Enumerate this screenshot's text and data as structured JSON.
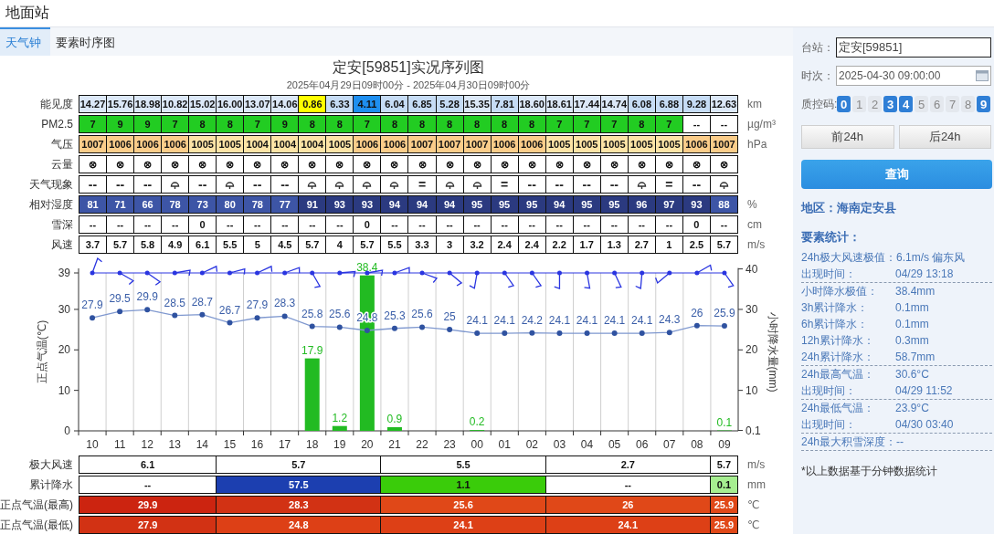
{
  "title_bar": {
    "title": "地面站"
  },
  "tabs": [
    {
      "label": "天气钟",
      "selected": true
    },
    {
      "label": "要素时序图",
      "selected": false
    }
  ],
  "chart_header": {
    "title": "定安[59851]实况序列图",
    "subtitle": "2025年04月29日09时00分 - 2025年04月30日09时00分"
  },
  "top_table": {
    "rows": [
      {
        "label": "能见度",
        "unit": "km",
        "cells": [
          {
            "text": "14.27",
            "color": "#dce8f8"
          },
          {
            "text": "15.76",
            "color": "#dce8f8"
          },
          {
            "text": "18.98",
            "color": "#dce8f8"
          },
          {
            "text": "10.82",
            "color": "#dce8f8"
          },
          {
            "text": "15.02",
            "color": "#dce8f8"
          },
          {
            "text": "16.00",
            "color": "#dce8f8"
          },
          {
            "text": "13.07",
            "color": "#dce8f8"
          },
          {
            "text": "14.06",
            "color": "#dce8f8"
          },
          {
            "text": "0.86",
            "color": "#ffff00"
          },
          {
            "text": "6.33",
            "color": "#c6dcf5"
          },
          {
            "text": "4.11",
            "color": "#1e8ff0"
          },
          {
            "text": "6.04",
            "color": "#c6dcf5"
          },
          {
            "text": "6.85",
            "color": "#c6dcf5"
          },
          {
            "text": "5.28",
            "color": "#c6dcf5"
          },
          {
            "text": "15.35",
            "color": "#dce8f8"
          },
          {
            "text": "7.81",
            "color": "#c6dcf5"
          },
          {
            "text": "18.60",
            "color": "#dce8f8"
          },
          {
            "text": "18.61",
            "color": "#dce8f8"
          },
          {
            "text": "17.44",
            "color": "#dce8f8"
          },
          {
            "text": "14.74",
            "color": "#dce8f8"
          },
          {
            "text": "6.08",
            "color": "#c6dcf5"
          },
          {
            "text": "6.88",
            "color": "#c6dcf5"
          },
          {
            "text": "9.28",
            "color": "#c6dcf5"
          },
          {
            "text": "12.63",
            "color": "#dce8f8"
          }
        ]
      },
      {
        "label": "PM2.5",
        "unit": "µg/m³",
        "cells": [
          {
            "text": "7",
            "color": "#22cc22"
          },
          {
            "text": "9",
            "color": "#22cc22"
          },
          {
            "text": "9",
            "color": "#22cc22"
          },
          {
            "text": "7",
            "color": "#22cc22"
          },
          {
            "text": "8",
            "color": "#22cc22"
          },
          {
            "text": "8",
            "color": "#22cc22"
          },
          {
            "text": "7",
            "color": "#22cc22"
          },
          {
            "text": "9",
            "color": "#22cc22"
          },
          {
            "text": "8",
            "color": "#22cc22"
          },
          {
            "text": "8",
            "color": "#22cc22"
          },
          {
            "text": "7",
            "color": "#22cc22"
          },
          {
            "text": "8",
            "color": "#22cc22"
          },
          {
            "text": "8",
            "color": "#22cc22"
          },
          {
            "text": "8",
            "color": "#22cc22"
          },
          {
            "text": "8",
            "color": "#22cc22"
          },
          {
            "text": "8",
            "color": "#22cc22"
          },
          {
            "text": "8",
            "color": "#22cc22"
          },
          {
            "text": "7",
            "color": "#22cc22"
          },
          {
            "text": "7",
            "color": "#22cc22"
          },
          {
            "text": "7",
            "color": "#22cc22"
          },
          {
            "text": "8",
            "color": "#22cc22"
          },
          {
            "text": "7",
            "color": "#22cc22"
          },
          {
            "text": "--",
            "color": "#ffffff"
          },
          {
            "text": "--",
            "color": "#ffffff"
          }
        ]
      },
      {
        "label": "气压",
        "unit": "hPa",
        "cells": [
          {
            "text": "1007",
            "color": "#fbcd8a"
          },
          {
            "text": "1006",
            "color": "#fbcd8a"
          },
          {
            "text": "1006",
            "color": "#fbcd8a"
          },
          {
            "text": "1006",
            "color": "#fbcd8a"
          },
          {
            "text": "1005",
            "color": "#fde4a6"
          },
          {
            "text": "1005",
            "color": "#fde4a6"
          },
          {
            "text": "1004",
            "color": "#fde4a6"
          },
          {
            "text": "1004",
            "color": "#fde4a6"
          },
          {
            "text": "1004",
            "color": "#fde4a6"
          },
          {
            "text": "1005",
            "color": "#fde4a6"
          },
          {
            "text": "1006",
            "color": "#fbcd8a"
          },
          {
            "text": "1006",
            "color": "#fbcd8a"
          },
          {
            "text": "1007",
            "color": "#fbcd8a"
          },
          {
            "text": "1007",
            "color": "#fbcd8a"
          },
          {
            "text": "1007",
            "color": "#fbcd8a"
          },
          {
            "text": "1006",
            "color": "#fbcd8a"
          },
          {
            "text": "1006",
            "color": "#fbcd8a"
          },
          {
            "text": "1005",
            "color": "#fde4a6"
          },
          {
            "text": "1005",
            "color": "#fde4a6"
          },
          {
            "text": "1005",
            "color": "#fde4a6"
          },
          {
            "text": "1005",
            "color": "#fde4a6"
          },
          {
            "text": "1005",
            "color": "#fde4a6"
          },
          {
            "text": "1006",
            "color": "#fbcd8a"
          },
          {
            "text": "1007",
            "color": "#fbcd8a"
          }
        ]
      },
      {
        "label": "云量",
        "cells": [
          {
            "text": "⊗"
          },
          {
            "text": "⊗"
          },
          {
            "text": "⊗"
          },
          {
            "text": "⊗"
          },
          {
            "text": "⊗"
          },
          {
            "text": "⊗"
          },
          {
            "text": "⊗"
          },
          {
            "text": "⊗"
          },
          {
            "text": "⊗"
          },
          {
            "text": "⊗"
          },
          {
            "text": "⊗"
          },
          {
            "text": "⊗"
          },
          {
            "text": "⊗"
          },
          {
            "text": "⊗"
          },
          {
            "text": "⊗"
          },
          {
            "text": "⊗"
          },
          {
            "text": "⊗"
          },
          {
            "text": "⊗"
          },
          {
            "text": "⊗"
          },
          {
            "text": "⊗"
          },
          {
            "text": "⊗"
          },
          {
            "text": "⊗"
          },
          {
            "text": "⊗"
          },
          {
            "text": "⊗"
          }
        ]
      },
      {
        "label": "天气现象",
        "cells": [
          {
            "kind": "text",
            "text": "--"
          },
          {
            "kind": "text",
            "text": "--"
          },
          {
            "kind": "text",
            "text": "--"
          },
          {
            "kind": "shower"
          },
          {
            "kind": "text",
            "text": "--"
          },
          {
            "kind": "shower"
          },
          {
            "kind": "text",
            "text": "--"
          },
          {
            "kind": "text",
            "text": "--"
          },
          {
            "kind": "shower"
          },
          {
            "kind": "shower"
          },
          {
            "kind": "shower"
          },
          {
            "kind": "shower"
          },
          {
            "kind": "text",
            "text": "="
          },
          {
            "kind": "shower"
          },
          {
            "kind": "shower"
          },
          {
            "kind": "text",
            "text": "="
          },
          {
            "kind": "text",
            "text": "--"
          },
          {
            "kind": "text",
            "text": "--"
          },
          {
            "kind": "text",
            "text": "--"
          },
          {
            "kind": "text",
            "text": "--"
          },
          {
            "kind": "shower"
          },
          {
            "kind": "text",
            "text": "="
          },
          {
            "kind": "text",
            "text": "--"
          },
          {
            "kind": "shower"
          }
        ]
      },
      {
        "label": "相对湿度",
        "unit": "%",
        "cells": [
          {
            "text": "81",
            "color": "#3d55a6"
          },
          {
            "text": "71",
            "color": "#3d55a6"
          },
          {
            "text": "66",
            "color": "#3d55a6"
          },
          {
            "text": "78",
            "color": "#3d55a6"
          },
          {
            "text": "73",
            "color": "#3d55a6"
          },
          {
            "text": "80",
            "color": "#3d55a6"
          },
          {
            "text": "78",
            "color": "#3d55a6"
          },
          {
            "text": "77",
            "color": "#3d55a6"
          },
          {
            "text": "91",
            "color": "#2b3a80"
          },
          {
            "text": "93",
            "color": "#2b3a80"
          },
          {
            "text": "93",
            "color": "#2b3a80"
          },
          {
            "text": "94",
            "color": "#2b3a80"
          },
          {
            "text": "94",
            "color": "#2b3a80"
          },
          {
            "text": "94",
            "color": "#2b3a80"
          },
          {
            "text": "95",
            "color": "#2b3a80"
          },
          {
            "text": "95",
            "color": "#2b3a80"
          },
          {
            "text": "95",
            "color": "#2b3a80"
          },
          {
            "text": "94",
            "color": "#2b3a80"
          },
          {
            "text": "95",
            "color": "#2b3a80"
          },
          {
            "text": "95",
            "color": "#2b3a80"
          },
          {
            "text": "96",
            "color": "#2b3a80"
          },
          {
            "text": "97",
            "color": "#2b3a80"
          },
          {
            "text": "93",
            "color": "#2b3a80"
          },
          {
            "text": "88",
            "color": "#3d55a6"
          }
        ]
      },
      {
        "label": "雪深",
        "unit": "cm",
        "cells": [
          {
            "text": "--"
          },
          {
            "text": "--"
          },
          {
            "text": "--"
          },
          {
            "text": "--"
          },
          {
            "text": "0"
          },
          {
            "text": "--"
          },
          {
            "text": "--"
          },
          {
            "text": "--"
          },
          {
            "text": "--"
          },
          {
            "text": "--"
          },
          {
            "text": "0"
          },
          {
            "text": "--"
          },
          {
            "text": "--"
          },
          {
            "text": "--"
          },
          {
            "text": "--"
          },
          {
            "text": "--"
          },
          {
            "text": "--"
          },
          {
            "text": "--"
          },
          {
            "text": "--"
          },
          {
            "text": "--"
          },
          {
            "text": "--"
          },
          {
            "text": "--"
          },
          {
            "text": "0"
          },
          {
            "text": "--"
          }
        ]
      },
      {
        "label": "风速",
        "unit": "m/s",
        "cells": [
          {
            "text": "3.7"
          },
          {
            "text": "5.7"
          },
          {
            "text": "5.8"
          },
          {
            "text": "4.9"
          },
          {
            "text": "6.1"
          },
          {
            "text": "5.5"
          },
          {
            "text": "5"
          },
          {
            "text": "4.5"
          },
          {
            "text": "5.7"
          },
          {
            "text": "4"
          },
          {
            "text": "5.7"
          },
          {
            "text": "5.5"
          },
          {
            "text": "3.3"
          },
          {
            "text": "3"
          },
          {
            "text": "3.2"
          },
          {
            "text": "2.4"
          },
          {
            "text": "2.4"
          },
          {
            "text": "2.2"
          },
          {
            "text": "1.7"
          },
          {
            "text": "1.3"
          },
          {
            "text": "2.7"
          },
          {
            "text": "1"
          },
          {
            "text": "2.5"
          },
          {
            "text": "5.7"
          }
        ]
      }
    ]
  },
  "chart": {
    "chart_data": {
      "type": "bar",
      "ylabel": "正点气温(℃)",
      "y2label": "小时降水量(mm)",
      "categories": [
        "10",
        "11",
        "12",
        "13",
        "14",
        "15",
        "16",
        "17",
        "18",
        "19",
        "20",
        "21",
        "22",
        "23",
        "00",
        "01",
        "02",
        "03",
        "04",
        "05",
        "06",
        "07",
        "08",
        "09"
      ],
      "ylim": [
        0,
        39
      ],
      "yticks": [
        0,
        10,
        20,
        30,
        39
      ],
      "y2lim": [
        0,
        40
      ],
      "y2ticks": [
        0.1,
        10,
        20,
        30,
        40
      ],
      "data_labels": true,
      "series": [
        {
          "type": "line",
          "marker": true,
          "color": "#2f52a0",
          "values": [
            27.9,
            29.5,
            29.9,
            28.5,
            28.7,
            26.7,
            27.9,
            28.3,
            25.8,
            25.6,
            24.8,
            25.3,
            25.6,
            25,
            24.1,
            24.1,
            24.2,
            24.1,
            24.1,
            24.1,
            24.1,
            24.3,
            26,
            25.9
          ]
        },
        {
          "type": "bar",
          "color": "#22bb22",
          "values": [
            null,
            null,
            null,
            null,
            null,
            null,
            null,
            null,
            17.9,
            1.2,
            38.4,
            0.9,
            null,
            null,
            0.2,
            null,
            null,
            null,
            null,
            null,
            null,
            null,
            null,
            0.1
          ]
        }
      ]
    }
  },
  "bottom_table": {
    "rows": [
      {
        "label": "极大风速",
        "unit": "m/s",
        "cells": [
          {
            "text": "6.1",
            "kind": "lead",
            "color": "#ffffff"
          },
          {
            "text": "5.7",
            "kind": "block",
            "color": "#ffffff"
          },
          {
            "text": "5.5",
            "kind": "block",
            "color": "#ffffff"
          },
          {
            "text": "2.7",
            "kind": "block",
            "color": "#ffffff"
          },
          {
            "text": "5.7",
            "kind": "tail",
            "color": "#ffffff"
          }
        ]
      },
      {
        "label": "累计降水",
        "unit": "mm",
        "cells": [
          {
            "text": "--",
            "kind": "lead",
            "color": "#ffffff"
          },
          {
            "text": "57.5",
            "kind": "block",
            "color": "#1c3fb0"
          },
          {
            "text": "1.1",
            "kind": "block",
            "color": "#3acc0a"
          },
          {
            "text": "--",
            "kind": "block",
            "color": "#ffffff"
          },
          {
            "text": "0.1",
            "kind": "tail",
            "color": "#a6ee90"
          }
        ]
      },
      {
        "label": "正点气温(最高)",
        "unit": "℃",
        "cells": [
          {
            "text": "29.9",
            "kind": "lead",
            "color": "#cc2410"
          },
          {
            "text": "28.3",
            "kind": "block",
            "color": "#d23214"
          },
          {
            "text": "25.6",
            "kind": "block",
            "color": "#e04818"
          },
          {
            "text": "26",
            "kind": "block",
            "color": "#e04818"
          },
          {
            "text": "25.9",
            "kind": "tail",
            "color": "#e04818"
          }
        ]
      },
      {
        "label": "正点气温(最低)",
        "unit": "℃",
        "cells": [
          {
            "text": "27.9",
            "kind": "lead",
            "color": "#d23214"
          },
          {
            "text": "24.8",
            "kind": "block",
            "color": "#dd4016"
          },
          {
            "text": "24.1",
            "kind": "block",
            "color": "#dd4016"
          },
          {
            "text": "24.1",
            "kind": "block",
            "color": "#dd4016"
          },
          {
            "text": "25.9",
            "kind": "tail",
            "color": "#e04818"
          }
        ]
      }
    ]
  },
  "sidebar": {
    "station": {
      "label": "台站：",
      "value": "定安[59851]"
    },
    "time": {
      "label": "时次：",
      "value": "2025-04-30 09:00:00"
    },
    "quality": {
      "label": "质控码:",
      "codes": [
        {
          "label": "0",
          "selected": true
        },
        {
          "label": "1",
          "selected": false
        },
        {
          "label": "2",
          "selected": false
        },
        {
          "label": "3",
          "selected": true
        },
        {
          "label": "4",
          "selected": true
        },
        {
          "label": "5",
          "selected": false
        },
        {
          "label": "6",
          "selected": false
        },
        {
          "label": "7",
          "selected": false
        },
        {
          "label": "8",
          "selected": false
        },
        {
          "label": "9",
          "selected": true
        }
      ]
    },
    "nav_buttons": [
      "前24h",
      "后24h"
    ],
    "query_button": "查询",
    "region": "地区：海南定安县",
    "stats_title": "要素统计：",
    "stats_groups": [
      [
        {
          "label": "24h极大风速极值：",
          "value": "6.1m/s 偏东风"
        },
        {
          "label": "出现时间：",
          "value": "04/29 13:18"
        }
      ],
      [
        {
          "label": "小时降水极值：",
          "value": "38.4mm"
        },
        {
          "label": "3h累计降水：",
          "value": "0.1mm"
        },
        {
          "label": "6h累计降水：",
          "value": "0.1mm"
        },
        {
          "label": "12h累计降水：",
          "value": "0.3mm"
        },
        {
          "label": "24h累计降水：",
          "value": "58.7mm"
        }
      ],
      [
        {
          "label": "24h最高气温：",
          "value": "30.6°C"
        },
        {
          "label": "出现时间：",
          "value": "04/29 11:52"
        }
      ],
      [
        {
          "label": "24h最低气温：",
          "value": "23.9°C"
        },
        {
          "label": "出现时间：",
          "value": "04/30 03:40"
        }
      ],
      [
        {
          "label": "24h最大积雪深度：--"
        }
      ]
    ],
    "footnote": "*以上数据基于分钟数据统计"
  }
}
